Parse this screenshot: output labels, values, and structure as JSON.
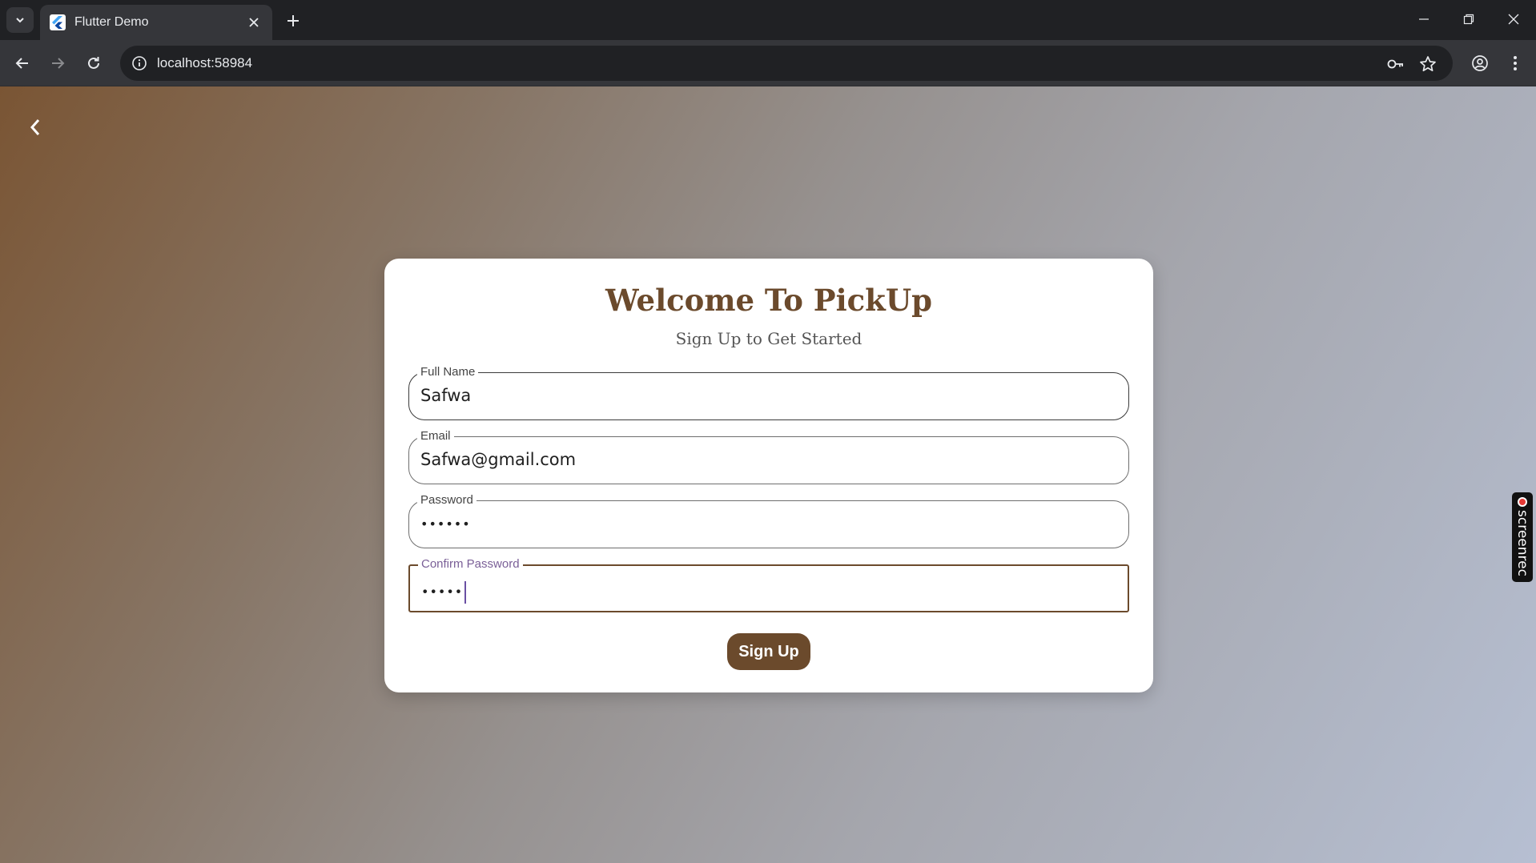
{
  "browser": {
    "tab_title": "Flutter Demo",
    "url": "localhost:58984"
  },
  "signup": {
    "title": "Welcome To PickUp",
    "subtitle": "Sign Up to Get Started",
    "full_name": {
      "label": "Full Name",
      "value": "Safwa"
    },
    "email": {
      "label": "Email",
      "value": "Safwa@gmail.com"
    },
    "password": {
      "label": "Password",
      "value": "••••••"
    },
    "confirm_password": {
      "label": "Confirm Password",
      "value": "•••••"
    },
    "submit_label": "Sign Up"
  },
  "recorder": {
    "label": "screenrec"
  },
  "colors": {
    "brand_brown": "#6b4a2c",
    "focus_purple": "#7a5f97"
  }
}
